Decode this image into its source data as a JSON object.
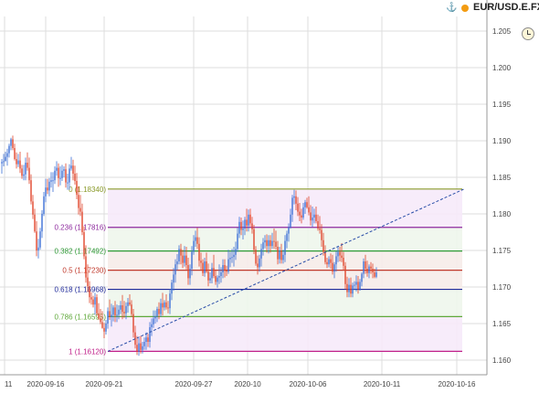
{
  "header": {
    "symbol": "EUR/USD.E.FX",
    "status_color": "#f39c12",
    "icons": [
      "anchor-icon",
      "clock-icon"
    ]
  },
  "chart_data": {
    "type": "candlestick",
    "y_axis": {
      "ticks": [
        "1.160",
        "1.165",
        "1.170",
        "1.175",
        "1.180",
        "1.185",
        "1.190",
        "1.195",
        "1.200",
        "1.205"
      ],
      "ylim": [
        1.158,
        1.207
      ]
    },
    "x_axis": {
      "ticks": [
        "11",
        "2020-09-16",
        "2020-09-21",
        "2020-09-27",
        "2020-10",
        "2020-10-06",
        "2020-10-11",
        "2020-10-16"
      ]
    },
    "colors": {
      "up": "#3b6fd6",
      "down": "#e0452b",
      "grid": "#dddddd"
    },
    "fibonacci": {
      "levels": [
        {
          "label": "0 (1.18340)",
          "value": 1.1834,
          "color": "#8a9a2a",
          "fill": "#f6eaf9"
        },
        {
          "label": "0.236 (1.17816)",
          "value": 1.17816,
          "color": "#8e2b9e",
          "fill": "#eef6ec"
        },
        {
          "label": "0.382 (1.17492)",
          "value": 1.17492,
          "color": "#2f9a36",
          "fill": "#f6ece9"
        },
        {
          "label": "0.5 (1.17230)",
          "value": 1.1723,
          "color": "#c0392b",
          "fill": "#f6ece9"
        },
        {
          "label": "0.618 (1.16968)",
          "value": 1.16968,
          "color": "#1f2a9a",
          "fill": "#eef6ec"
        },
        {
          "label": "0.786 (1.16595)",
          "value": 1.16595,
          "color": "#5fa83a",
          "fill": "#f6eaf9"
        },
        {
          "label": "1 (1.16120)",
          "value": 1.1612,
          "color": "#c0208a",
          "fill": "#f6eaf9"
        }
      ]
    },
    "trendline": {
      "from": {
        "index": 58,
        "value": 1.1612
      },
      "to": {
        "index": 253,
        "value": 1.1834
      },
      "color": "#2a4ea8"
    },
    "candles": [
      [
        1.1869,
        1.1875,
        1.1855,
        1.1871
      ],
      [
        1.1871,
        1.1882,
        1.1865,
        1.1872
      ],
      [
        1.1872,
        1.1885,
        1.1872,
        1.1878
      ],
      [
        1.1878,
        1.1889,
        1.1866,
        1.1883
      ],
      [
        1.1883,
        1.1896,
        1.1877,
        1.1893
      ],
      [
        1.1893,
        1.1904,
        1.1887,
        1.1902
      ],
      [
        1.1902,
        1.1907,
        1.1887,
        1.189
      ],
      [
        1.189,
        1.1896,
        1.1873,
        1.1875
      ],
      [
        1.1875,
        1.1884,
        1.1862,
        1.1868
      ],
      [
        1.1868,
        1.1882,
        1.1864,
        1.1873
      ],
      [
        1.1873,
        1.1885,
        1.1856,
        1.1862
      ],
      [
        1.1862,
        1.1867,
        1.1848,
        1.1852
      ],
      [
        1.1852,
        1.1867,
        1.1846,
        1.1854
      ],
      [
        1.1854,
        1.1877,
        1.1846,
        1.187
      ],
      [
        1.187,
        1.1884,
        1.1859,
        1.1863
      ],
      [
        1.1863,
        1.1877,
        1.1841,
        1.1846
      ],
      [
        1.1846,
        1.1854,
        1.1813,
        1.1817
      ],
      [
        1.1817,
        1.1826,
        1.1793,
        1.1799
      ],
      [
        1.1799,
        1.1807,
        1.1774,
        1.1776
      ],
      [
        1.1776,
        1.179,
        1.1742,
        1.175
      ],
      [
        1.175,
        1.1766,
        1.1739,
        1.1754
      ],
      [
        1.1754,
        1.1781,
        1.1751,
        1.1776
      ],
      [
        1.1776,
        1.1805,
        1.1767,
        1.18
      ],
      [
        1.18,
        1.183,
        1.1797,
        1.1824
      ],
      [
        1.1824,
        1.1848,
        1.1816,
        1.1836
      ],
      [
        1.1836,
        1.1848,
        1.1827,
        1.1832
      ],
      [
        1.1832,
        1.1849,
        1.1824,
        1.1844
      ],
      [
        1.1844,
        1.1857,
        1.1836,
        1.1846
      ],
      [
        1.1846,
        1.1857,
        1.183,
        1.1846
      ],
      [
        1.1846,
        1.1865,
        1.1841,
        1.1859
      ],
      [
        1.1859,
        1.1872,
        1.1852,
        1.1863
      ],
      [
        1.1863,
        1.1869,
        1.1837,
        1.1849
      ],
      [
        1.1849,
        1.1865,
        1.1839,
        1.1849
      ],
      [
        1.1849,
        1.1867,
        1.1845,
        1.1859
      ],
      [
        1.1859,
        1.1865,
        1.185,
        1.1861
      ],
      [
        1.1861,
        1.1869,
        1.1836,
        1.1843
      ],
      [
        1.1843,
        1.1855,
        1.1833,
        1.1843
      ],
      [
        1.1843,
        1.1868,
        1.1833,
        1.1862
      ],
      [
        1.1862,
        1.1878,
        1.1859,
        1.1866
      ],
      [
        1.1866,
        1.1874,
        1.1846,
        1.1855
      ],
      [
        1.1855,
        1.1866,
        1.184,
        1.1845
      ],
      [
        1.1845,
        1.1856,
        1.182,
        1.1826
      ],
      [
        1.1826,
        1.1838,
        1.1799,
        1.1808
      ],
      [
        1.1808,
        1.1826,
        1.1797,
        1.1803
      ],
      [
        1.1803,
        1.1814,
        1.1771,
        1.1775
      ],
      [
        1.1775,
        1.1783,
        1.1738,
        1.1742
      ],
      [
        1.1742,
        1.1757,
        1.1706,
        1.1713
      ],
      [
        1.1713,
        1.1731,
        1.1693,
        1.1701
      ],
      [
        1.1701,
        1.1708,
        1.1678,
        1.1686
      ],
      [
        1.1686,
        1.1693,
        1.1676,
        1.1683
      ],
      [
        1.1683,
        1.1688,
        1.1672,
        1.1676
      ],
      [
        1.1676,
        1.1692,
        1.1662,
        1.1686
      ],
      [
        1.1686,
        1.169,
        1.1661,
        1.1664
      ],
      [
        1.1664,
        1.1678,
        1.1655,
        1.1657
      ],
      [
        1.1657,
        1.167,
        1.1649,
        1.1652
      ],
      [
        1.1652,
        1.1667,
        1.1643,
        1.1644
      ],
      [
        1.1644,
        1.1651,
        1.163,
        1.1639
      ],
      [
        1.1639,
        1.1655,
        1.1635,
        1.165
      ],
      [
        1.165,
        1.1672,
        1.1643,
        1.1667
      ],
      [
        1.1667,
        1.1683,
        1.1655,
        1.1659
      ],
      [
        1.1659,
        1.1677,
        1.1646,
        1.1662
      ],
      [
        1.1662,
        1.1675,
        1.1653,
        1.1672
      ],
      [
        1.1672,
        1.1681,
        1.1652,
        1.1661
      ],
      [
        1.1661,
        1.1676,
        1.1652,
        1.1662
      ],
      [
        1.1662,
        1.1675,
        1.1656,
        1.1669
      ],
      [
        1.1669,
        1.1681,
        1.1663,
        1.1675
      ],
      [
        1.1675,
        1.1689,
        1.1656,
        1.1666
      ],
      [
        1.1666,
        1.1681,
        1.1658,
        1.1664
      ],
      [
        1.1664,
        1.1679,
        1.1656,
        1.1674
      ],
      [
        1.1674,
        1.1685,
        1.1665,
        1.1679
      ],
      [
        1.1679,
        1.169,
        1.1674,
        1.1676
      ],
      [
        1.1676,
        1.1682,
        1.1659,
        1.1663
      ],
      [
        1.1663,
        1.167,
        1.1631,
        1.1638
      ],
      [
        1.1638,
        1.1647,
        1.1616,
        1.1621
      ],
      [
        1.1621,
        1.1633,
        1.1607,
        1.1612
      ],
      [
        1.1612,
        1.163,
        1.1606,
        1.1623
      ],
      [
        1.1623,
        1.1633,
        1.1609,
        1.1614
      ],
      [
        1.1614,
        1.1625,
        1.1609,
        1.1619
      ],
      [
        1.1619,
        1.1631,
        1.1614,
        1.1625
      ],
      [
        1.1625,
        1.1638,
        1.1614,
        1.1631
      ],
      [
        1.1631,
        1.1636,
        1.1618,
        1.1625
      ],
      [
        1.1625,
        1.1652,
        1.1617,
        1.1645
      ],
      [
        1.1645,
        1.1657,
        1.1633,
        1.1649
      ],
      [
        1.1649,
        1.1668,
        1.1644,
        1.1657
      ],
      [
        1.1657,
        1.1668,
        1.165,
        1.166
      ],
      [
        1.166,
        1.1673,
        1.1652,
        1.167
      ],
      [
        1.167,
        1.1679,
        1.1656,
        1.1663
      ],
      [
        1.1663,
        1.1684,
        1.1659,
        1.1678
      ],
      [
        1.1678,
        1.1692,
        1.1661,
        1.1672
      ],
      [
        1.1672,
        1.1682,
        1.1668,
        1.1679
      ],
      [
        1.1679,
        1.169,
        1.1669,
        1.1672
      ],
      [
        1.1672,
        1.1681,
        1.1664,
        1.1671
      ],
      [
        1.1671,
        1.1697,
        1.1663,
        1.1691
      ],
      [
        1.1691,
        1.171,
        1.1682,
        1.1706
      ],
      [
        1.1706,
        1.1726,
        1.1695,
        1.1717
      ],
      [
        1.1717,
        1.1738,
        1.1706,
        1.1731
      ],
      [
        1.1731,
        1.1745,
        1.1723,
        1.1735
      ],
      [
        1.1735,
        1.1757,
        1.1731,
        1.1752
      ],
      [
        1.1752,
        1.1759,
        1.1731,
        1.1743
      ],
      [
        1.1743,
        1.1751,
        1.1726,
        1.1733
      ],
      [
        1.1733,
        1.1756,
        1.1728,
        1.1743
      ],
      [
        1.1743,
        1.1755,
        1.1724,
        1.173
      ],
      [
        1.173,
        1.174,
        1.1703,
        1.1712
      ],
      [
        1.1712,
        1.1731,
        1.1703,
        1.1725
      ],
      [
        1.1725,
        1.1756,
        1.1716,
        1.1748
      ],
      [
        1.1748,
        1.1771,
        1.1744,
        1.1763
      ],
      [
        1.1763,
        1.1777,
        1.1755,
        1.1768
      ],
      [
        1.1768,
        1.1781,
        1.1752,
        1.1759
      ],
      [
        1.1759,
        1.1768,
        1.1728,
        1.1736
      ],
      [
        1.1736,
        1.1747,
        1.1723,
        1.1733
      ],
      [
        1.1733,
        1.1738,
        1.1715,
        1.1719
      ],
      [
        1.1719,
        1.174,
        1.1714,
        1.1735
      ],
      [
        1.1735,
        1.1747,
        1.1719,
        1.1721
      ],
      [
        1.1721,
        1.1732,
        1.1701,
        1.1709
      ],
      [
        1.1709,
        1.172,
        1.1705,
        1.1712
      ],
      [
        1.1712,
        1.1733,
        1.1705,
        1.1726
      ],
      [
        1.1726,
        1.1744,
        1.1712,
        1.1715
      ],
      [
        1.1715,
        1.1724,
        1.1703,
        1.1707
      ],
      [
        1.1707,
        1.1716,
        1.1699,
        1.1713
      ],
      [
        1.1713,
        1.1731,
        1.1704,
        1.1715
      ],
      [
        1.1715,
        1.1727,
        1.1706,
        1.172
      ],
      [
        1.172,
        1.1738,
        1.1712,
        1.173
      ],
      [
        1.173,
        1.1738,
        1.1713,
        1.1723
      ],
      [
        1.1723,
        1.1729,
        1.1715,
        1.1721
      ],
      [
        1.1721,
        1.1751,
        1.1718,
        1.1738
      ],
      [
        1.1738,
        1.1748,
        1.1727,
        1.174
      ],
      [
        1.174,
        1.1752,
        1.1733,
        1.1741
      ],
      [
        1.1741,
        1.1755,
        1.1728,
        1.1744
      ],
      [
        1.1744,
        1.1762,
        1.1737,
        1.1752
      ],
      [
        1.1752,
        1.1781,
        1.1748,
        1.1773
      ],
      [
        1.1773,
        1.1796,
        1.1767,
        1.1789
      ],
      [
        1.1789,
        1.1795,
        1.1771,
        1.1778
      ],
      [
        1.1778,
        1.1791,
        1.1765,
        1.178
      ],
      [
        1.178,
        1.1796,
        1.1771,
        1.1792
      ],
      [
        1.1792,
        1.1807,
        1.1776,
        1.1784
      ],
      [
        1.1784,
        1.1806,
        1.1776,
        1.1799
      ],
      [
        1.1799,
        1.1807,
        1.1783,
        1.1787
      ],
      [
        1.1787,
        1.1796,
        1.1773,
        1.1779
      ],
      [
        1.1779,
        1.1785,
        1.1745,
        1.1751
      ],
      [
        1.1751,
        1.1756,
        1.1729,
        1.1732
      ],
      [
        1.1732,
        1.1743,
        1.1717,
        1.1727
      ],
      [
        1.1727,
        1.1744,
        1.1721,
        1.1739
      ],
      [
        1.1739,
        1.1759,
        1.1728,
        1.1752
      ],
      [
        1.1752,
        1.1767,
        1.1743,
        1.1761
      ],
      [
        1.1761,
        1.1771,
        1.1753,
        1.1764
      ],
      [
        1.1764,
        1.1772,
        1.1747,
        1.1756
      ],
      [
        1.1756,
        1.1771,
        1.1746,
        1.1764
      ],
      [
        1.1764,
        1.1771,
        1.1747,
        1.1756
      ],
      [
        1.1756,
        1.1774,
        1.1752,
        1.1763
      ],
      [
        1.1763,
        1.178,
        1.1752,
        1.1762
      ],
      [
        1.1762,
        1.1777,
        1.1751,
        1.1755
      ],
      [
        1.1755,
        1.1763,
        1.1731,
        1.1738
      ],
      [
        1.1738,
        1.1755,
        1.1732,
        1.175
      ],
      [
        1.175,
        1.1759,
        1.1732,
        1.1737
      ],
      [
        1.1737,
        1.1751,
        1.1732,
        1.1744
      ],
      [
        1.1744,
        1.1771,
        1.1734,
        1.1763
      ],
      [
        1.1763,
        1.1777,
        1.1753,
        1.1773
      ],
      [
        1.1773,
        1.1787,
        1.1762,
        1.1782
      ],
      [
        1.1782,
        1.1807,
        1.178,
        1.1799
      ],
      [
        1.1799,
        1.1826,
        1.1789,
        1.1822
      ],
      [
        1.1822,
        1.1833,
        1.1813,
        1.1824
      ],
      [
        1.1824,
        1.1832,
        1.1805,
        1.1814
      ],
      [
        1.1814,
        1.1823,
        1.1797,
        1.1803
      ],
      [
        1.1803,
        1.1815,
        1.179,
        1.1798
      ],
      [
        1.1798,
        1.1807,
        1.1787,
        1.1795
      ],
      [
        1.1795,
        1.1815,
        1.1792,
        1.1809
      ],
      [
        1.1809,
        1.1819,
        1.18,
        1.1816
      ],
      [
        1.1816,
        1.1822,
        1.1807,
        1.1809
      ],
      [
        1.1809,
        1.1824,
        1.1798,
        1.1802
      ],
      [
        1.1802,
        1.1812,
        1.1784,
        1.1791
      ],
      [
        1.1791,
        1.181,
        1.1782,
        1.1795
      ],
      [
        1.1795,
        1.1807,
        1.1787,
        1.1799
      ],
      [
        1.1799,
        1.181,
        1.1787,
        1.179
      ],
      [
        1.179,
        1.1799,
        1.1777,
        1.178
      ],
      [
        1.178,
        1.1797,
        1.1773,
        1.1778
      ],
      [
        1.1778,
        1.1786,
        1.1755,
        1.1764
      ],
      [
        1.1764,
        1.1774,
        1.1743,
        1.1748
      ],
      [
        1.1748,
        1.1757,
        1.1731,
        1.1734
      ],
      [
        1.1734,
        1.174,
        1.1726,
        1.1731
      ],
      [
        1.1731,
        1.1742,
        1.1727,
        1.1738
      ],
      [
        1.1738,
        1.1746,
        1.1725,
        1.1733
      ],
      [
        1.1733,
        1.1744,
        1.1717,
        1.1721
      ],
      [
        1.1721,
        1.1734,
        1.1712,
        1.1731
      ],
      [
        1.1731,
        1.1749,
        1.1721,
        1.1742
      ],
      [
        1.1742,
        1.1755,
        1.1734,
        1.1748
      ],
      [
        1.1748,
        1.1755,
        1.1735,
        1.1743
      ],
      [
        1.1743,
        1.176,
        1.1734,
        1.174
      ],
      [
        1.174,
        1.1748,
        1.1723,
        1.1729
      ],
      [
        1.1729,
        1.1734,
        1.1697,
        1.1704
      ],
      [
        1.1704,
        1.1714,
        1.1686,
        1.1693
      ],
      [
        1.1693,
        1.1712,
        1.1686,
        1.1703
      ],
      [
        1.1703,
        1.1713,
        1.1686,
        1.1691
      ],
      [
        1.1691,
        1.1706,
        1.1686,
        1.1702
      ],
      [
        1.1702,
        1.1708,
        1.1696,
        1.1703
      ],
      [
        1.1703,
        1.1716,
        1.1694,
        1.1707
      ],
      [
        1.1707,
        1.1715,
        1.1691,
        1.1697
      ],
      [
        1.1697,
        1.1711,
        1.1695,
        1.1707
      ],
      [
        1.1707,
        1.172,
        1.1701,
        1.1718
      ],
      [
        1.1718,
        1.1739,
        1.1712,
        1.1735
      ],
      [
        1.1735,
        1.1744,
        1.1718,
        1.1725
      ],
      [
        1.1725,
        1.1736,
        1.1714,
        1.1719
      ],
      [
        1.1719,
        1.1731,
        1.1712,
        1.1728
      ],
      [
        1.1728,
        1.1734,
        1.1718,
        1.1725
      ],
      [
        1.1725,
        1.1732,
        1.1712,
        1.172
      ],
      [
        1.172,
        1.1725,
        1.1712,
        1.1714
      ],
      [
        1.1714,
        1.1727,
        1.1712,
        1.172
      ]
    ]
  }
}
